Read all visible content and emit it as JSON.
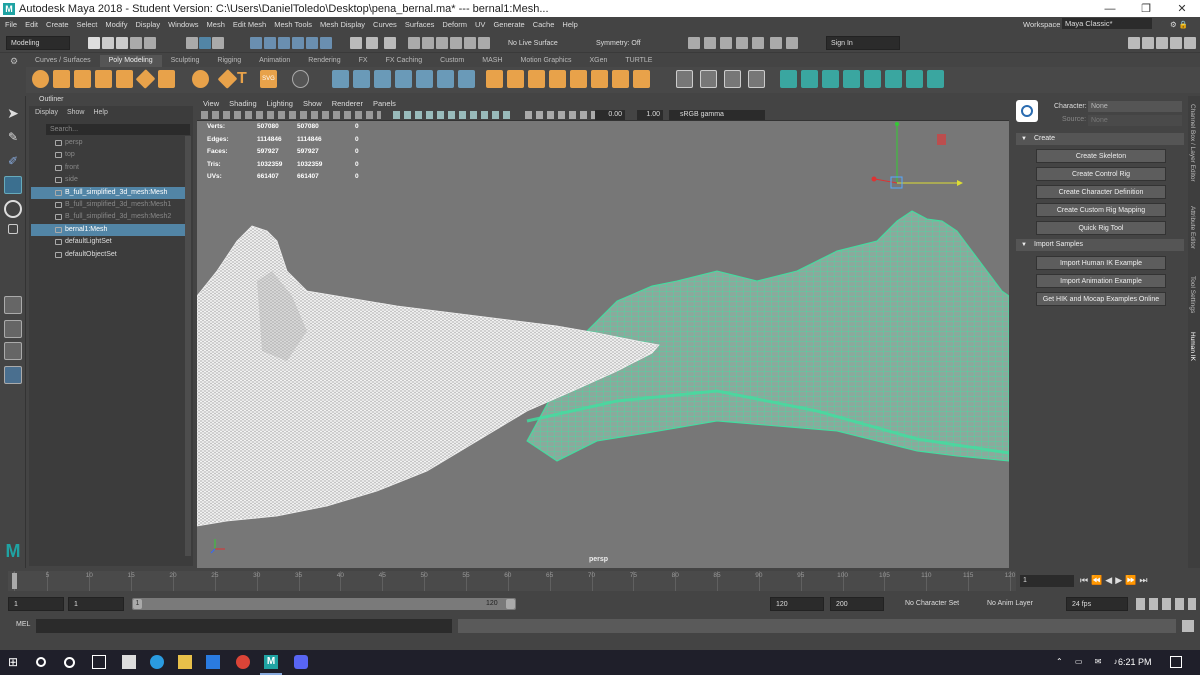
{
  "titlebar": {
    "title": "Autodesk Maya 2018 - Student Version: C:\\Users\\DanielToledo\\Desktop\\pena_bernal.ma*  ---  bernal1:Mesh...",
    "minimize": "—",
    "maximize": "❐",
    "close": "✕"
  },
  "menubar": {
    "items": [
      "File",
      "Edit",
      "Create",
      "Select",
      "Modify",
      "Display",
      "Windows",
      "Mesh",
      "Edit Mesh",
      "Mesh Tools",
      "Mesh Display",
      "Curves",
      "Surfaces",
      "Deform",
      "UV",
      "Generate",
      "Cache",
      "Help"
    ],
    "workspace_label": "Workspace :",
    "workspace_value": "Maya Classic*"
  },
  "statusline": {
    "mode": "Modeling",
    "live_surface": "No Live Surface",
    "symmetry": "Symmetry: Off",
    "sign_in": "Sign In"
  },
  "shelf": {
    "tabs": [
      "Curves / Surfaces",
      "Poly Modeling",
      "Sculpting",
      "Rigging",
      "Animation",
      "Rendering",
      "FX",
      "FX Caching",
      "Custom",
      "MASH",
      "Motion Graphics",
      "XGen",
      "TURTLE"
    ],
    "active_tab": "Poly Modeling"
  },
  "outliner": {
    "title": "Outliner",
    "menu": [
      "Display",
      "Show",
      "Help"
    ],
    "search_placeholder": "Search...",
    "items": [
      {
        "label": "persp",
        "state": "dim"
      },
      {
        "label": "top",
        "state": "dim"
      },
      {
        "label": "front",
        "state": "dim"
      },
      {
        "label": "side",
        "state": "dim"
      },
      {
        "label": "B_full_simplified_3d_mesh:Mesh",
        "state": "selected"
      },
      {
        "label": "B_full_simplified_3d_mesh:Mesh1",
        "state": "dim"
      },
      {
        "label": "B_full_simplified_3d_mesh:Mesh2",
        "state": "dim"
      },
      {
        "label": "bernal1:Mesh",
        "state": "selected"
      },
      {
        "label": "defaultLightSet",
        "state": "normal"
      },
      {
        "label": "defaultObjectSet",
        "state": "normal"
      }
    ]
  },
  "viewport": {
    "menu": [
      "View",
      "Shading",
      "Lighting",
      "Show",
      "Renderer",
      "Panels"
    ],
    "exposure": "0.00",
    "gamma": "1.00",
    "color_space": "sRGB gamma",
    "camera": "persp",
    "hud": [
      {
        "label": "Verts:",
        "v1": "507080",
        "v2": "507080",
        "v3": "0"
      },
      {
        "label": "Edges:",
        "v1": "1114846",
        "v2": "1114846",
        "v3": "0"
      },
      {
        "label": "Faces:",
        "v1": "597927",
        "v2": "597927",
        "v3": "0"
      },
      {
        "label": "Tris:",
        "v1": "1032359",
        "v2": "1032359",
        "v3": "0"
      },
      {
        "label": "UVs:",
        "v1": "661407",
        "v2": "661407",
        "v3": "0"
      }
    ]
  },
  "humanik": {
    "character_label": "Character:",
    "character_value": "None",
    "source_label": "Source:",
    "source_value": "None",
    "create_section": "Create",
    "create_buttons": [
      "Create Skeleton",
      "Create Control Rig",
      "Create Character Definition",
      "Create Custom Rig Mapping",
      "Quick Rig Tool"
    ],
    "import_section": "Import Samples",
    "import_buttons": [
      "Import Human IK Example",
      "Import Animation Example",
      "Get HIK and Mocap Examples Online"
    ]
  },
  "side_tabs": [
    "Channel Box / Layer Editor",
    "Attribute Editor",
    "Tool Settings",
    "Human IK"
  ],
  "timeslider": {
    "ticks": [
      "1",
      "5",
      "10",
      "15",
      "20",
      "25",
      "30",
      "35",
      "40",
      "45",
      "50",
      "55",
      "60",
      "65",
      "70",
      "75",
      "80",
      "85",
      "90",
      "95",
      "100",
      "105",
      "110",
      "115",
      "120"
    ],
    "current_frame": "1"
  },
  "rangeslider": {
    "start": "1",
    "start2": "1",
    "range_start": "1",
    "range_end": "120",
    "end": "120",
    "end2": "200",
    "character_set": "No Character Set",
    "anim_layer": "No Anim Layer",
    "fps": "24 fps"
  },
  "cmdline": {
    "label": "MEL"
  },
  "taskbar": {
    "time": "6:21 PM"
  },
  "colors": {
    "selection_blue": "#5285a6",
    "mesh_green": "#3fe0a0",
    "maya_teal": "#1fa3a3"
  }
}
